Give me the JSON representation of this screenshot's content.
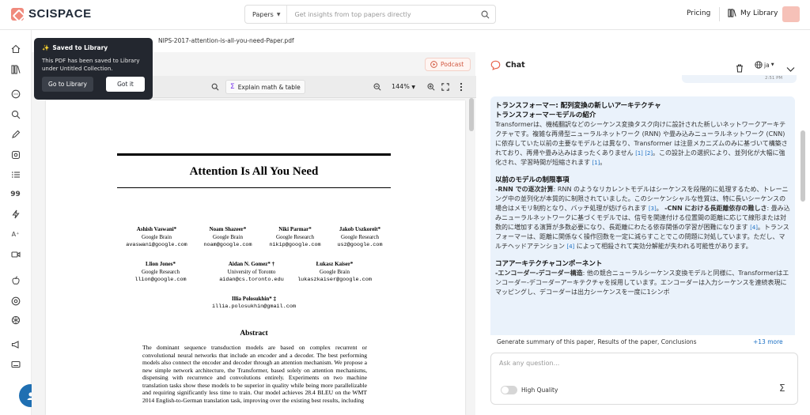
{
  "header": {
    "logo_text": "SCISPACE",
    "search_scope": "Papers",
    "search_placeholder": "Get insights from top papers directly",
    "pricing_label": "Pricing",
    "my_library_label": "My Library"
  },
  "breadcrumb": "NIPS-2017-attention-is-all-you-need-Paper.pdf",
  "toast": {
    "title": "Saved to Library",
    "body": "This PDF has been saved to Library under Untitled Collection.",
    "go_label": "Go to Library",
    "got_label": "Got it"
  },
  "pdf_toolbar": {
    "podcast_label": "Podcast",
    "explain_label": "Explain math & table",
    "zoom": "144%"
  },
  "paper": {
    "title": "Attention Is All You Need",
    "authors": [
      {
        "name": "Ashish Vaswani*",
        "org": "Google Brain",
        "email": "avaswani@google.com"
      },
      {
        "name": "Noam Shazeer*",
        "org": "Google Brain",
        "email": "noam@google.com"
      },
      {
        "name": "Niki Parmar*",
        "org": "Google Research",
        "email": "nikip@google.com"
      },
      {
        "name": "Jakob Uszkoreit*",
        "org": "Google Research",
        "email": "usz@google.com"
      },
      {
        "name": "Llion Jones*",
        "org": "Google Research",
        "email": "llion@google.com"
      },
      {
        "name": "Aidan N. Gomez* †",
        "org": "University of Toronto",
        "email": "aidan@cs.toronto.edu"
      },
      {
        "name": "Łukasz Kaiser*",
        "org": "Google Brain",
        "email": "lukaszkaiser@google.com"
      },
      {
        "name": "Illia Polosukhin* ‡",
        "org": "",
        "email": "illia.polosukhin@gmail.com"
      }
    ],
    "abstract_heading": "Abstract",
    "abstract_text": "The dominant sequence transduction models are based on complex recurrent or convolutional neural networks that include an encoder and a decoder. The best performing models also connect the encoder and decoder through an attention mechanism. We propose a new simple network architecture, the Transformer, based solely on attention mechanisms, dispensing with recurrence and convolutions entirely. Experiments on two machine translation tasks show these models to be superior in quality while being more parallelizable and requiring significantly less time to train. Our model achieves 28.4 BLEU on the WMT 2014 English-to-German translation task, improving over the existing best results, including"
  },
  "chat": {
    "title": "Chat",
    "language": "ja",
    "timestamp": "2:51 PM",
    "message": {
      "h1": "トランスフォーマー: 配列変換の新しいアーキテクチャ",
      "h2": "トランスフォーマーモデルの紹介",
      "p1a": "Transformerは、機械翻訳などのシーケンス変換タスク向けに設計された新しいネットワークアーキテクチャです。複雑な再帰型ニューラルネットワーク (RNN) や畳み込みニューラルネットワーク (CNN) に依存していた以前の主要なモデルとは異なり、Transformer は注意メカニズムのみに基づいて構築されており、再帰や畳み込みはまったくありません",
      "c1": "[1]",
      "c2": "[2]",
      "p1b": "。この設計上の選択により、並列化が大幅に強化され、学習時間が短縮されます",
      "c3": "[1]",
      "h3": "以前のモデルの制限事項",
      "b1": "-RNN での逐次計算",
      "p2a": ": RNN のようなリカレントモデルはシーケンスを段階的に処理するため、トレーニング中の並列化が本質的に制限されていました。このシーケンシャルな性質は、特に長いシーケンスの場合はメモリ制約となり、バッチ処理が妨げられます",
      "c4": "[3]",
      "b2": "-CNN における長距離依存の難しさ",
      "p2b": ": 畳み込みニューラルネットワークに基づくモデルでは、信号を関連付ける位置間の距離に応じて線形または対数的に増加する演算が多数必要になり、長距離にわたる依存関係の学習が困難になります",
      "c5": "[4]",
      "p2c": "。トランスフォーマーは、距離に関係なく操作回数を一定に減らすことでこの問題に対処しています。ただし、マルチヘッドアテンション",
      "c6": "[4]",
      "p2d": " によって相殺されて実効分解能が失われる可能性があります。",
      "h4": "コアアーキテクチャコンポーネント",
      "b3": "-エンコーダー-デコーダー構造",
      "p3": ": 他の競合ニューラルシーケンス変換モデルと同様に、Transformerはエンコーダー-デコーダーアーキテクチャを採用しています。エンコーダーは入力シーケンスを連続表現にマッピングし、デコーダーは出力シーケンスを一度に1シンボ"
    },
    "suggestions": "Generate summary of this paper, Results of the paper, Conclusions",
    "more_label": "+13 more",
    "input_placeholder": "Ask any question...",
    "high_quality_label": "High Quality"
  }
}
